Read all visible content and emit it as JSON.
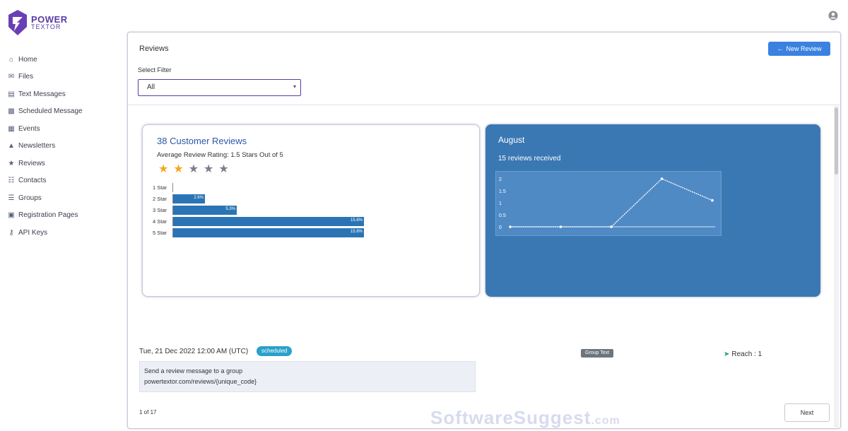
{
  "brand": {
    "line1": "POWER",
    "line2": "TEXTOR"
  },
  "sidebar": {
    "items": [
      {
        "label": "Home",
        "icon": "home-icon"
      },
      {
        "label": "Files",
        "icon": "mail-icon"
      },
      {
        "label": "Text Messages",
        "icon": "message-icon"
      },
      {
        "label": "Scheduled Message",
        "icon": "calendar-message-icon"
      },
      {
        "label": "Events",
        "icon": "calendar-icon"
      },
      {
        "label": "Newsletters",
        "icon": "newsletter-icon"
      },
      {
        "label": "Reviews",
        "icon": "star-icon"
      },
      {
        "label": "Contacts",
        "icon": "contacts-icon"
      },
      {
        "label": "Groups",
        "icon": "groups-icon"
      },
      {
        "label": "Registration Pages",
        "icon": "page-icon"
      },
      {
        "label": "API Keys",
        "icon": "key-icon"
      }
    ]
  },
  "main": {
    "title": "Reviews",
    "back_button": "New Review",
    "filter_label": "Select Filter",
    "filter_value": "All"
  },
  "summary": {
    "title": "38 Customer Reviews",
    "subtitle": "Average Review Rating: 1.5 Stars Out of 5",
    "rating_stars": 1.5,
    "star_colors": {
      "filled": "#f3a81c",
      "empty": "#7a7f8a"
    },
    "bars": [
      {
        "label": "1 Star",
        "percent": 0,
        "text": ""
      },
      {
        "label": "2 Star",
        "percent": 15,
        "text": "2.6%"
      },
      {
        "label": "3 Star",
        "percent": 30,
        "text": "5.3%"
      },
      {
        "label": "4 Star",
        "percent": 90,
        "text": "15.8%"
      },
      {
        "label": "5 Star",
        "percent": 90,
        "text": "15.8%"
      }
    ]
  },
  "month": {
    "title": "August",
    "subtitle": "15 reviews received",
    "bg_color": "#3a78b3"
  },
  "chart_data": {
    "type": "line",
    "x": [
      1,
      2,
      3,
      4,
      5
    ],
    "y": [
      0,
      0,
      0,
      2,
      1.1
    ],
    "ylim": [
      0,
      2
    ],
    "ytick_labels": [
      "0",
      "0.5",
      "1",
      "1.5",
      "2"
    ]
  },
  "message": {
    "date": "Tue, 21 Dec 2022 12:00 AM (UTC)",
    "badge": "scheduled",
    "type_tag": "Group Text",
    "reach": "Reach : 1",
    "body_line1": "Send a review message to a group",
    "body_line2": "powertextor.com/reviews/{unique_code}",
    "pager": "1 of 17",
    "next": "Next"
  },
  "watermark": {
    "text": "SoftwareSuggest",
    "domain": ".com"
  }
}
